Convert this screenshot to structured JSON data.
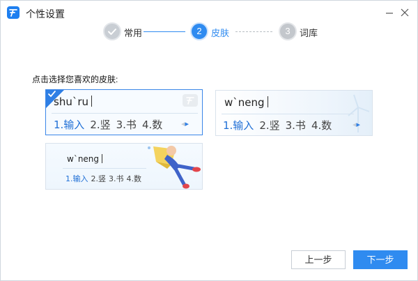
{
  "window": {
    "title": "个性设置",
    "accent_color": "#2f8bf0"
  },
  "steps": [
    {
      "number": "✓",
      "label": "常用",
      "state": "done"
    },
    {
      "number": "2",
      "label": "皮肤",
      "state": "active"
    },
    {
      "number": "3",
      "label": "词库",
      "state": "pending"
    }
  ],
  "main": {
    "prompt": "点击选择您喜欢的皮肤:"
  },
  "skins": [
    {
      "composition": "shu`ru",
      "candidates": [
        "1.输入",
        "2.竖",
        "3.书",
        "4.数"
      ],
      "selected": true,
      "pager_prev": "◂",
      "pager_next": "▸"
    },
    {
      "composition": "w`neng",
      "candidates": [
        "1.输入",
        "2.竖",
        "3.书",
        "4.数"
      ],
      "selected": false,
      "pager_prev": "◂",
      "pager_next": "▸"
    },
    {
      "composition": "w`neng",
      "candidates": [
        "1.输入",
        "2.竖",
        "3.书",
        "4.数"
      ],
      "selected": false
    }
  ],
  "footer": {
    "prev_label": "上一步",
    "next_label": "下一步"
  }
}
